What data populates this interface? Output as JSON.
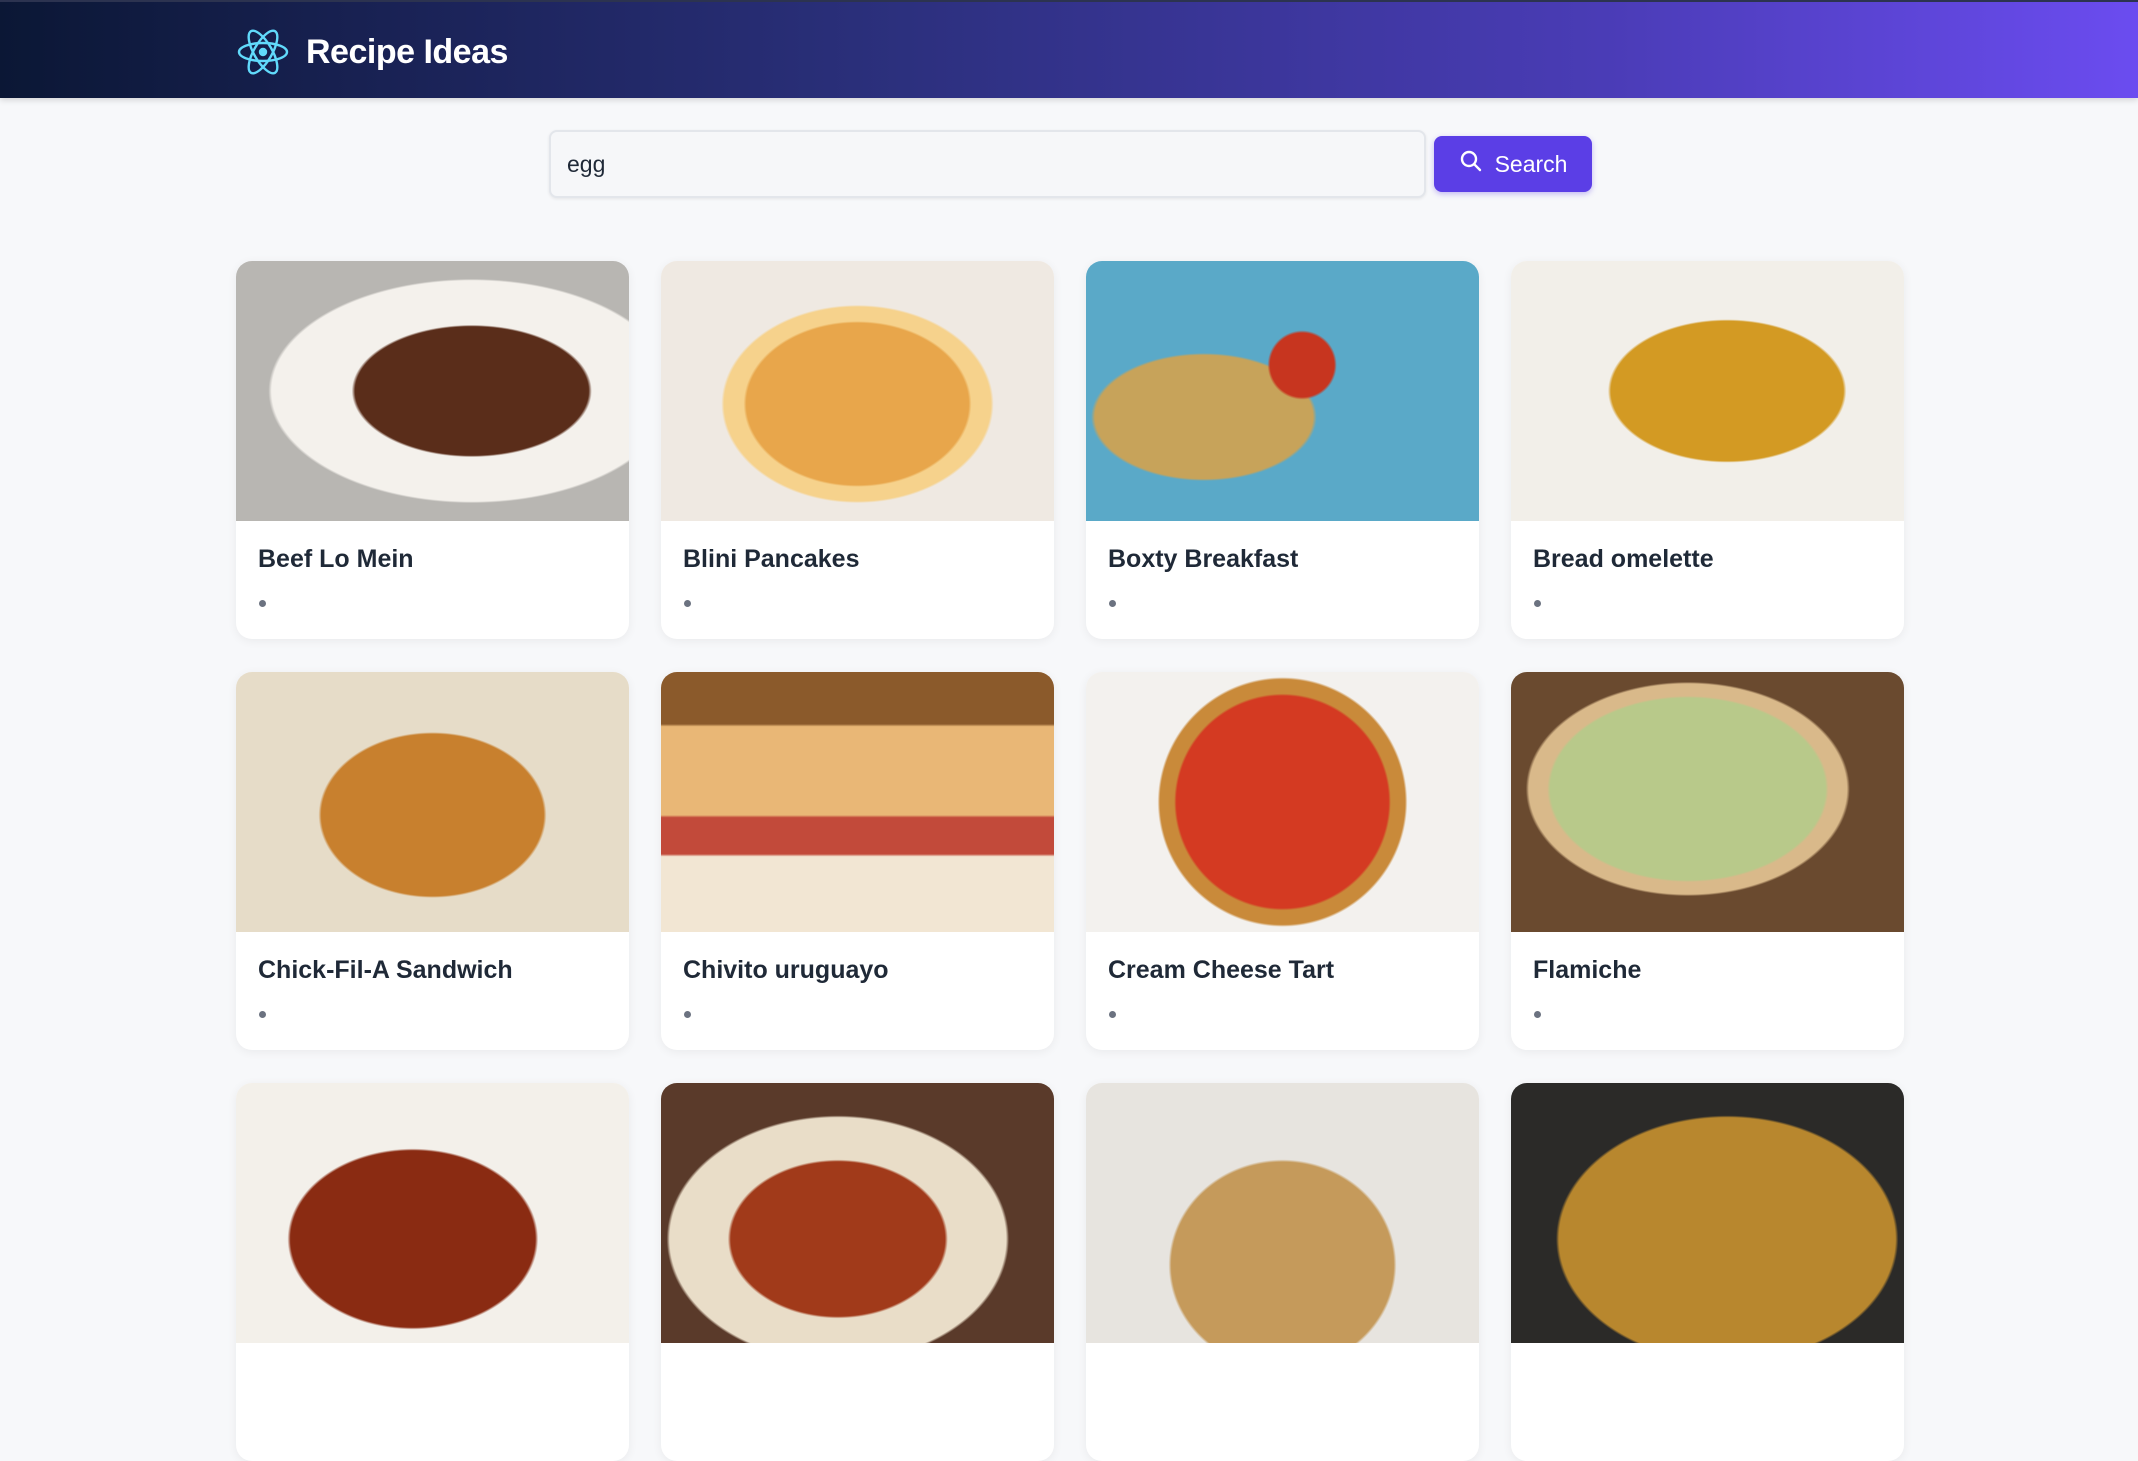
{
  "app": {
    "title": "Recipe Ideas",
    "logo_icon": "react-atom-icon"
  },
  "search": {
    "value": "egg",
    "placeholder": "Search recipes",
    "button_label": "Search",
    "button_icon": "search-icon"
  },
  "colors": {
    "accent": "#5b3ee6",
    "header_start": "#0b1735",
    "header_end": "#6b4cf0"
  },
  "recipes": [
    {
      "name": "Beef Lo Mein"
    },
    {
      "name": "Blini Pancakes"
    },
    {
      "name": "Boxty Breakfast"
    },
    {
      "name": "Bread omelette"
    },
    {
      "name": "Chick-Fil-A Sandwich"
    },
    {
      "name": "Chivito uruguayo"
    },
    {
      "name": "Cream Cheese Tart"
    },
    {
      "name": "Flamiche"
    },
    {
      "name": ""
    },
    {
      "name": ""
    },
    {
      "name": ""
    },
    {
      "name": ""
    }
  ]
}
